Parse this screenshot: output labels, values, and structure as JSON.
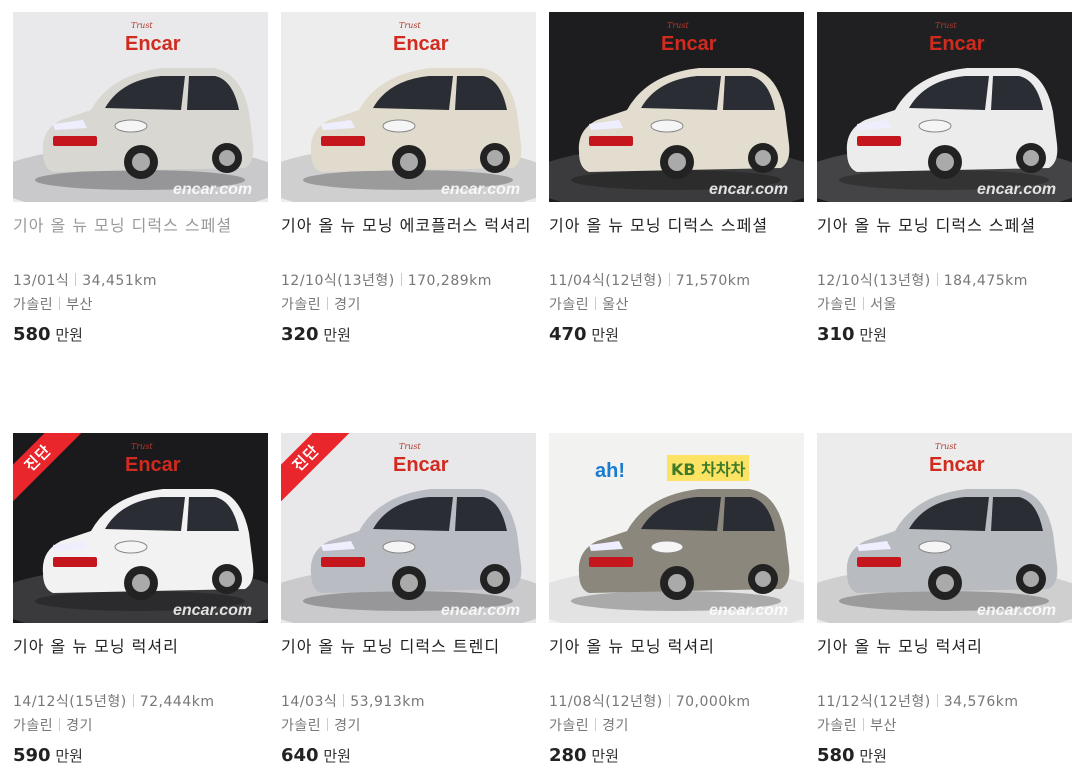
{
  "watermark_brand": "Encar",
  "watermark_site": "encar.com",
  "badge_diag": "진단",
  "price_unit": "만원",
  "cards": [
    {
      "title": "기아 올 뉴 모닝 디럭스 스페셜",
      "year": "13/01식",
      "km": "34,451km",
      "fuel": "가솔린",
      "region": "부산",
      "price": "580",
      "dim": true,
      "diag": false,
      "bg": "#e9e9eb",
      "floor": "#c9c9cc",
      "car": "#d9d7d1",
      "logo": "encar"
    },
    {
      "title": "기아 올 뉴 모닝 에코플러스 럭셔리",
      "year": "12/10식(13년형)",
      "km": "170,289km",
      "fuel": "가솔린",
      "region": "경기",
      "price": "320",
      "dim": false,
      "diag": false,
      "bg": "#ededed",
      "floor": "#cfcfcf",
      "car": "#e0dbcc",
      "logo": "encar"
    },
    {
      "title": "기아 올 뉴 모닝 디럭스 스페셜",
      "year": "11/04식(12년형)",
      "km": "71,570km",
      "fuel": "가솔린",
      "region": "울산",
      "price": "470",
      "dim": false,
      "diag": false,
      "bg": "#1d1d1f",
      "floor": "#3b3b3d",
      "car": "#e3ddd0",
      "logo": "encar"
    },
    {
      "title": "기아 올 뉴 모닝 디럭스 스페셜",
      "year": "12/10식(13년형)",
      "km": "184,475km",
      "fuel": "가솔린",
      "region": "서울",
      "price": "310",
      "dim": false,
      "diag": false,
      "bg": "#202022",
      "floor": "#444446",
      "car": "#ececec",
      "logo": "encar"
    },
    {
      "title": "기아 올 뉴 모닝 럭셔리",
      "year": "14/12식(15년형)",
      "km": "72,444km",
      "fuel": "가솔린",
      "region": "경기",
      "price": "590",
      "dim": false,
      "diag": true,
      "bg": "#1a1a1c",
      "floor": "#3a3a3c",
      "car": "#f2f2f2",
      "logo": "encar"
    },
    {
      "title": "기아 올 뉴 모닝 디럭스 트렌디",
      "year": "14/03식",
      "km": "53,913km",
      "fuel": "가솔린",
      "region": "경기",
      "price": "640",
      "dim": false,
      "diag": true,
      "bg": "#e8e8ea",
      "floor": "#cacacc",
      "car": "#b9bcc2",
      "logo": "encar"
    },
    {
      "title": "기아 올 뉴 모닝 럭셔리",
      "year": "11/08식(12년형)",
      "km": "70,000km",
      "fuel": "가솔린",
      "region": "경기",
      "price": "280",
      "dim": false,
      "diag": false,
      "bg": "#f2f2f0",
      "floor": "#e3e3e3",
      "car": "#8c877c",
      "logo": "kb",
      "logo_text1": "ah!",
      "logo_text2": "KB 차차차"
    },
    {
      "title": "기아 올 뉴 모닝 럭셔리",
      "year": "11/12식(12년형)",
      "km": "34,576km",
      "fuel": "가솔린",
      "region": "부산",
      "price": "580",
      "dim": false,
      "diag": false,
      "bg": "#ececec",
      "floor": "#cfcfcf",
      "car": "#b8bbc0",
      "logo": "encar"
    }
  ]
}
